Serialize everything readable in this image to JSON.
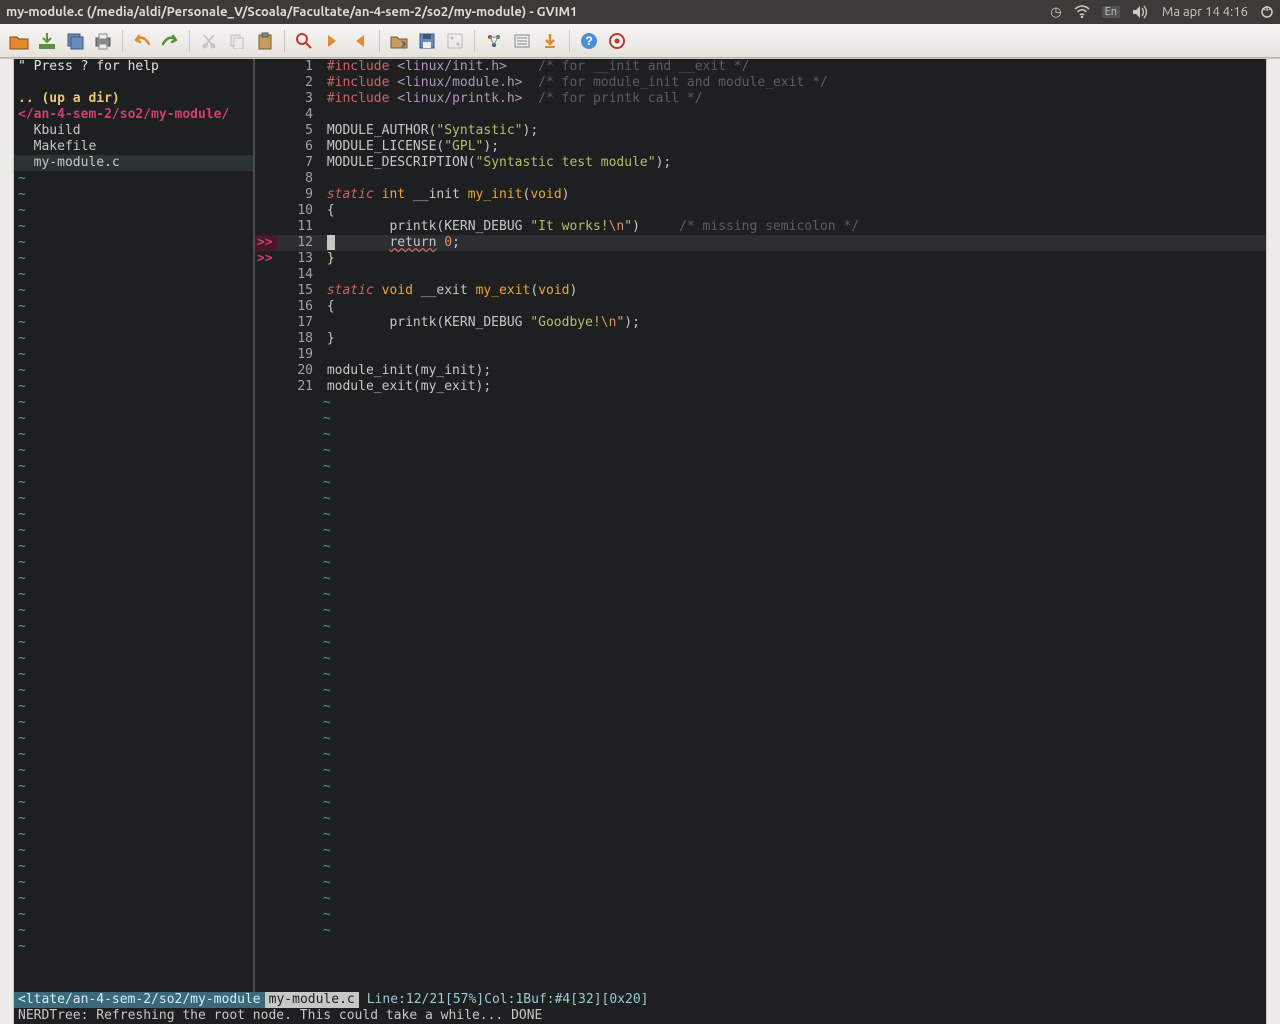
{
  "menubar": {
    "title": "my-module.c (/media/aldi/Personale_V/Scoala/Facultate/an-4-sem-2/so2/my-module) - GVIM1",
    "lang": "En",
    "datetime": "Ma apr 14  4:16"
  },
  "toolbar_icons": [
    "open-icon",
    "save-icon",
    "save-all-icon",
    "print-icon",
    "|",
    "undo-icon",
    "redo-icon",
    "|",
    "cut-icon",
    "copy-icon",
    "paste-icon",
    "|",
    "find-replace-icon",
    "find-next-icon",
    "find-prev-icon",
    "|",
    "load-session-icon",
    "save-session-icon",
    "run-script-icon",
    "|",
    "make-icon",
    "shell-icon",
    "tag-jump-icon",
    "|",
    "help-icon",
    "find-help-icon"
  ],
  "nerdtree": {
    "help": "\" Press ? for help",
    "up": ".. (up a dir)",
    "dir": "</an-4-sem-2/so2/my-module/",
    "files": [
      "Kbuild",
      "Makefile",
      "my-module.c"
    ],
    "selected_index": 2
  },
  "code": {
    "error_rows": [
      12,
      13
    ],
    "cursor_row": 12,
    "lines": [
      {
        "n": 1,
        "html": "<span class='pp'>#include</span> <span class='inc'>&lt;linux/init.h&gt;</span>    <span class='cmt'>/* for __init and __exit */</span>"
      },
      {
        "n": 2,
        "html": "<span class='pp'>#include</span> <span class='inc'>&lt;linux/module.h&gt;</span>  <span class='cmt'>/* for module_init and module_exit */</span>"
      },
      {
        "n": 3,
        "html": "<span class='pp'>#include</span> <span class='inc'>&lt;linux/printk.h&gt;</span>  <span class='cmt'>/* for printk call */</span>"
      },
      {
        "n": 4,
        "html": ""
      },
      {
        "n": 5,
        "html": "MODULE_AUTHOR(<span class='str'>\"Syntastic\"</span>);"
      },
      {
        "n": 6,
        "html": "MODULE_LICENSE(<span class='str'>\"GPL\"</span>);"
      },
      {
        "n": 7,
        "html": "MODULE_DESCRIPTION(<span class='str'>\"Syntastic test module\"</span>);"
      },
      {
        "n": 8,
        "html": ""
      },
      {
        "n": 9,
        "html": "<span class='kw'>static</span> <span class='ty'>int</span> __init <span class='fn'>my_init</span>(<span class='void'>void</span>)"
      },
      {
        "n": 10,
        "html": "{"
      },
      {
        "n": 11,
        "html": "        printk(KERN_DEBUG <span class='str'>\"It works!</span><span class='esc'>\\n</span><span class='str'>\"</span>)     <span class='cmt'>/* missing semicolon */</span>"
      },
      {
        "n": 12,
        "html": "<span class='cursor'> </span>       <span class='err'>return</span> <span class='num2'>0</span>;"
      },
      {
        "n": 13,
        "html": "<span class='brace'>}</span>"
      },
      {
        "n": 14,
        "html": ""
      },
      {
        "n": 15,
        "html": "<span class='kw'>static</span> <span class='ty'>void</span> __exit <span class='fn'>my_exit</span>(<span class='void'>void</span>)"
      },
      {
        "n": 16,
        "html": "{"
      },
      {
        "n": 17,
        "html": "        printk(KERN_DEBUG <span class='str'>\"Goodbye!</span><span class='esc'>\\n</span><span class='str'>\"</span>);"
      },
      {
        "n": 18,
        "html": "}"
      },
      {
        "n": 19,
        "html": ""
      },
      {
        "n": 20,
        "html": "module_init(my_init);"
      },
      {
        "n": 21,
        "html": "module_exit(my_exit);"
      }
    ]
  },
  "statusline": {
    "path": "<ltate/an-4-sem-2/so2/my-module",
    "file": "my-module.c",
    "rest": "Line:12/21[57%]Col:1Buf:#4[32][0x20]"
  },
  "cmdline": "NERDTree: Refreshing the root node. This could take a while... DONE"
}
